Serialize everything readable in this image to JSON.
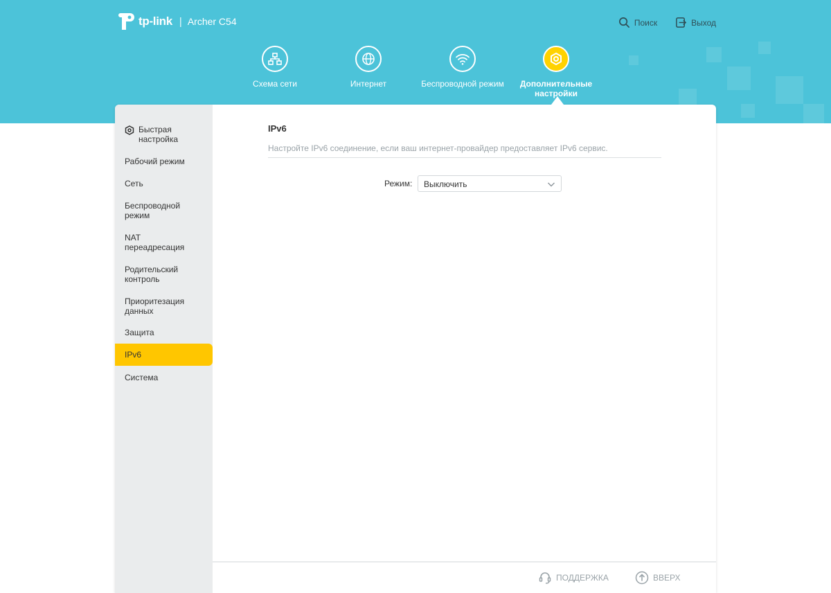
{
  "header": {
    "logo_text": "tp-link",
    "separator": "|",
    "model": "Archer C54",
    "search_label": "Поиск",
    "logout_label": "Выход"
  },
  "main_nav": {
    "items": [
      {
        "label": "Схема сети",
        "icon": "network-map-icon",
        "active": false
      },
      {
        "label": "Интернет",
        "icon": "globe-icon",
        "active": false
      },
      {
        "label": "Беспроводной режим",
        "icon": "wifi-icon",
        "active": false
      },
      {
        "label": "Дополнительные настройки",
        "icon": "gear-icon",
        "active": true
      }
    ]
  },
  "sidebar": {
    "items": [
      {
        "label": "Быстрая настройка",
        "icon": "gear-icon",
        "active": false
      },
      {
        "label": "Рабочий режим",
        "active": false
      },
      {
        "label": "Сеть",
        "active": false
      },
      {
        "label": "Беспроводной режим",
        "active": false
      },
      {
        "label": "NAT переадресация",
        "active": false
      },
      {
        "label": "Родительский контроль",
        "active": false
      },
      {
        "label": "Приоритезация данных",
        "active": false
      },
      {
        "label": "Защита",
        "active": false
      },
      {
        "label": "IPv6",
        "active": true
      },
      {
        "label": "Система",
        "active": false
      }
    ]
  },
  "content": {
    "title": "IPv6",
    "description": "Настройте IPv6 соединение, если ваш интернет-провайдер предоставляет IPv6 сервис.",
    "mode_label": "Режим:",
    "mode_value": "Выключить"
  },
  "footer": {
    "support_label": "ПОДДЕРЖКА",
    "top_label": "ВВЕРХ"
  },
  "colors": {
    "header": "#4cc3d9",
    "accent": "#ffc600",
    "sidebar": "#eaeced"
  }
}
